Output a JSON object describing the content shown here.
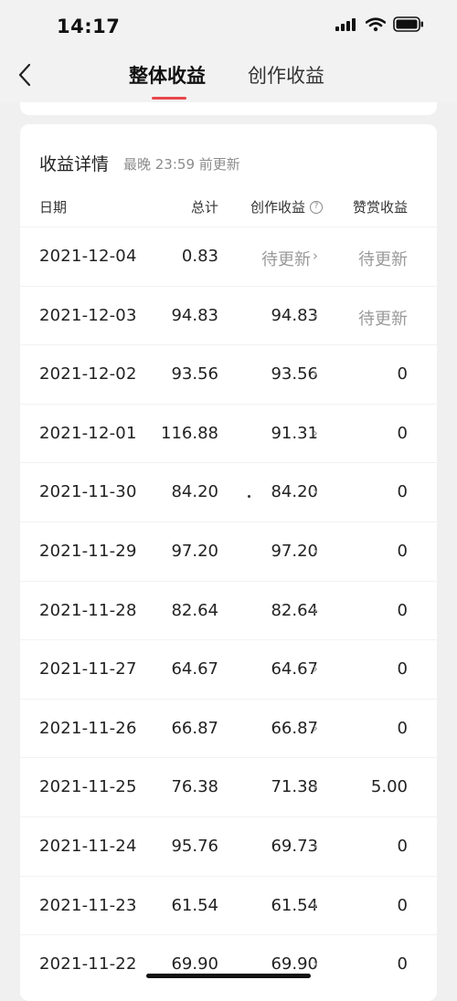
{
  "status_bar": {
    "time": "14:17"
  },
  "nav": {
    "tabs": [
      {
        "label": "整体收益"
      },
      {
        "label": "创作收益"
      }
    ]
  },
  "card": {
    "title": "收益详情",
    "subtitle": "最晚 23:59 前更新",
    "columns": {
      "date": "日期",
      "total": "总计",
      "creation": "创作收益",
      "tip": "赞赏收益"
    },
    "rows": [
      {
        "date": "2021-12-04",
        "total": "0.83",
        "creation": "待更新",
        "tip": "待更新"
      },
      {
        "date": "2021-12-03",
        "total": "94.83",
        "creation": "94.83",
        "tip": "待更新"
      },
      {
        "date": "2021-12-02",
        "total": "93.56",
        "creation": "93.56",
        "tip": "0"
      },
      {
        "date": "2021-12-01",
        "total": "116.88",
        "creation": "91.31",
        "tip": "0"
      },
      {
        "date": "2021-11-30",
        "total": "84.20",
        "creation": "84.20",
        "tip": "0"
      },
      {
        "date": "2021-11-29",
        "total": "97.20",
        "creation": "97.20",
        "tip": "0"
      },
      {
        "date": "2021-11-28",
        "total": "82.64",
        "creation": "82.64",
        "tip": "0"
      },
      {
        "date": "2021-11-27",
        "total": "64.67",
        "creation": "64.67",
        "tip": "0"
      },
      {
        "date": "2021-11-26",
        "total": "66.87",
        "creation": "66.87",
        "tip": "0"
      },
      {
        "date": "2021-11-25",
        "total": "76.38",
        "creation": "71.38",
        "tip": "5.00"
      },
      {
        "date": "2021-11-24",
        "total": "95.76",
        "creation": "69.73",
        "tip": "0"
      },
      {
        "date": "2021-11-23",
        "total": "61.54",
        "creation": "61.54",
        "tip": "0"
      },
      {
        "date": "2021-11-22",
        "total": "69.90",
        "creation": "69.90",
        "tip": "0"
      }
    ]
  },
  "colors": {
    "accent": "#e8464b",
    "background": "#f0f0f0",
    "card": "#ffffff",
    "muted_text": "#9a9a9a"
  },
  "icons": {
    "back": "chevron-left-icon",
    "row_more": "chevron-right-icon",
    "help": "question-circle-icon",
    "signal": "signal-icon",
    "wifi": "wifi-icon",
    "battery": "battery-icon"
  }
}
